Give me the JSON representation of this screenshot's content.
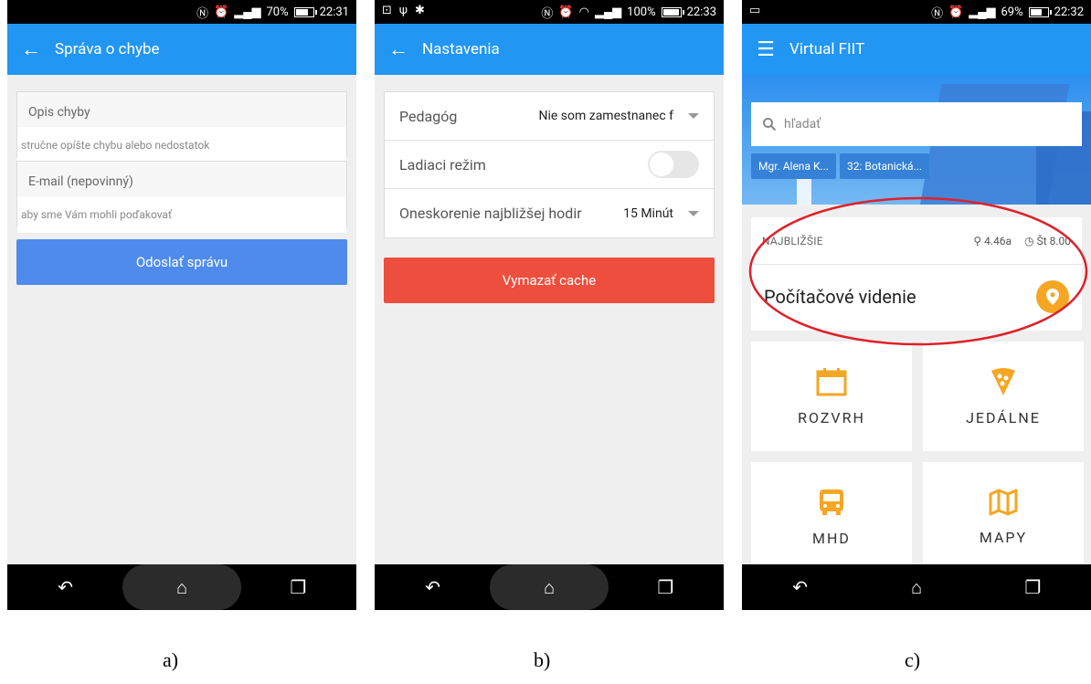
{
  "screens": {
    "a": {
      "status": {
        "battery": "70%",
        "time": "22:31"
      },
      "title": "Správa o chybe",
      "fields": [
        {
          "label": "Opis chyby",
          "placeholder": "stručne opíšte chybu alebo nedostatok"
        },
        {
          "label": "E-mail (nepovinný)",
          "placeholder": "aby sme Vám mohli poďakovať"
        }
      ],
      "submit": "Odoslať správu",
      "caption": "a)"
    },
    "b": {
      "status": {
        "battery": "100%",
        "time": "22:33"
      },
      "title": "Nastavenia",
      "rows": [
        {
          "label": "Pedagóg",
          "value": "Nie som zamestnanec f"
        },
        {
          "label": "Ladiaci režim"
        },
        {
          "label": "Oneskorenie najbližšej hodir",
          "value": "15 Minút"
        }
      ],
      "clear_cache": "Vymazať cache",
      "caption": "b)"
    },
    "c": {
      "status": {
        "battery": "69%",
        "time": "22:32"
      },
      "title": "Virtual FIIT",
      "search_placeholder": "hľadať",
      "chips": [
        "Mgr. Alena K...",
        "32: Botanická..."
      ],
      "next": {
        "label": "NAJBLIŽŠIE",
        "room": "4.46a",
        "time": "Št 8.00",
        "course": "Počítačové videnie"
      },
      "tiles": [
        "ROZVRH",
        "JEDÁLNE",
        "MHD",
        "MAPY"
      ],
      "caption": "c)"
    }
  },
  "colors": {
    "primary": "#2196f3",
    "accent": "#f5a623",
    "danger": "#ee4e3d",
    "button_blue": "#4f8bec"
  }
}
